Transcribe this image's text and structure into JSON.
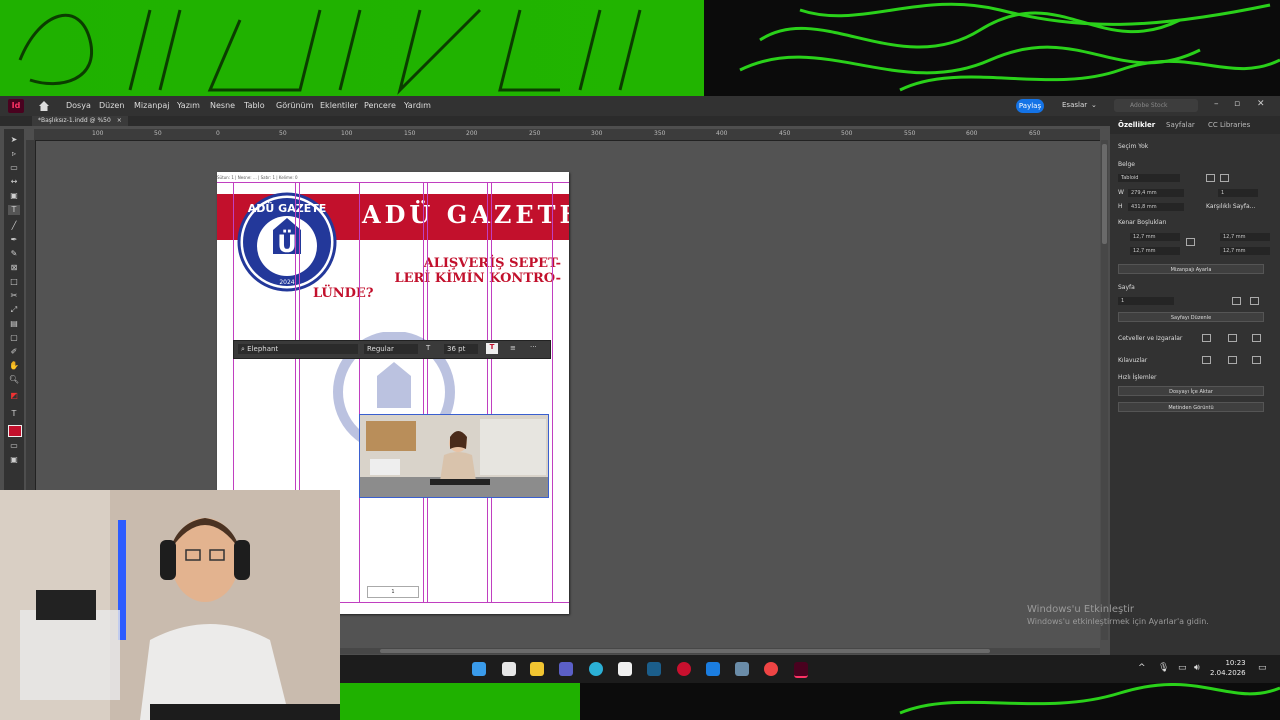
{
  "app": {
    "logo": "Id",
    "menu": [
      "Dosya",
      "Düzen",
      "Mizanpaj",
      "Yazım",
      "Nesne",
      "Tablo",
      "Görünüm",
      "Eklentiler",
      "Pencere",
      "Yardım"
    ],
    "share_label": "Paylaş",
    "workspace_label": "Esaslar",
    "stock_search_placeholder": "Adobe Stock"
  },
  "document": {
    "tab_label": "*Başlıksız-1.indd @ %50",
    "tab_close": "×",
    "ruler_ticks": [
      "100",
      "50",
      "0",
      "50",
      "100",
      "150",
      "200",
      "250",
      "300",
      "350",
      "400",
      "450",
      "500",
      "550",
      "600",
      "650"
    ],
    "frame_info": "Sütun: 1 | Nesne: ... | Satır: 1 | Kelime: 0"
  },
  "page": {
    "masthead": "ADÜ GAZETE",
    "seal_text": "ADÜ GAZETE",
    "seal_letter": "Ü",
    "seal_year": "2024",
    "headline_lines": [
      "ALIŞVERİŞ SEPET-",
      "LERİ KİMİN KONTRO-",
      "LÜNDE?"
    ],
    "page_number": "1"
  },
  "text_toolbar": {
    "font": "Elephant",
    "style": "Regular",
    "size": "36 pt"
  },
  "properties_panel": {
    "tabs": [
      "Özellikler",
      "Sayfalar",
      "CC Libraries"
    ],
    "no_selection": "Seçim Yok",
    "document_label": "Belge",
    "document_preset": "Tabloid",
    "width": "279,4 mm",
    "height": "431,8 mm",
    "pages_count": "1",
    "facing_pages": "Karşılıklı Sayfa...",
    "margins_label": "Kenar Boşlukları",
    "margin_top": "12,7 mm",
    "margin_bottom": "12,7 mm",
    "margin_left": "12,7 mm",
    "margin_right": "12,7 mm",
    "adjust_layout": "Mizanpajı Ayarla",
    "page_label": "Sayfa",
    "page_value": "1",
    "edit_page": "Sayfayı Düzenle",
    "grids_label": "Cetveller ve Izgaralar",
    "guides_label": "Kılavuzlar",
    "quick_actions": "Hızlı İşlemler",
    "import_file": "Dosyayı İçe Aktar",
    "edit_text": "Metinden Görüntü"
  },
  "windows": {
    "activation_title": "Windows'u Etkinleştir",
    "activation_sub": "Windows'u etkinleştirmek için Ayarlar'a gidin.",
    "time": "10:23",
    "date": "2.04.2026"
  },
  "colors": {
    "masthead_red": "#c2102c",
    "guide_magenta": "#c03fc0",
    "seal_blue": "#23389a",
    "banner_green": "#1fb100",
    "share_blue": "#1473e6"
  }
}
